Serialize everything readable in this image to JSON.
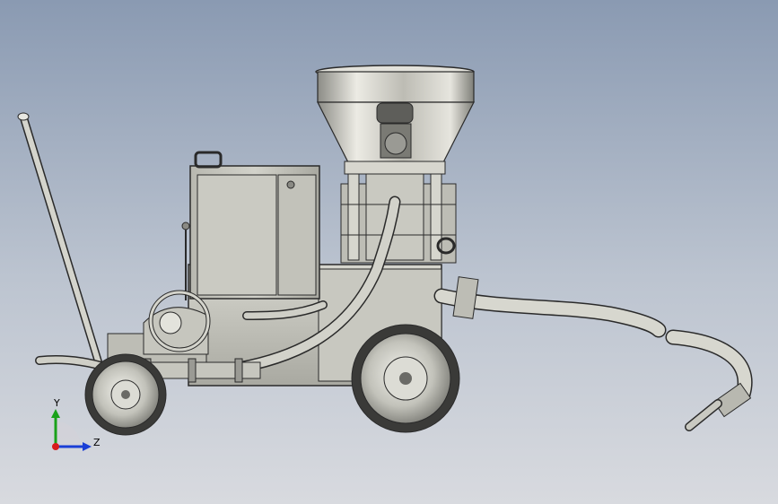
{
  "viewport": {
    "background_top": "#8a9ab2",
    "background_bottom": "#d8dadf"
  },
  "model": {
    "parts": [
      "hopper",
      "motor",
      "control-cabinet",
      "chassis-frame",
      "handle-bar",
      "front-wheel",
      "rear-wheel",
      "air-hose",
      "material-hose",
      "nozzle",
      "gauge"
    ],
    "metal_color": "#c4c4bc",
    "edge_color": "#2a2a2a"
  },
  "triad": {
    "y_label": "Y",
    "z_label": "Z",
    "y_color": "#1aa21a",
    "z_color": "#1a3fd6",
    "origin_color": "#d81c1c"
  }
}
